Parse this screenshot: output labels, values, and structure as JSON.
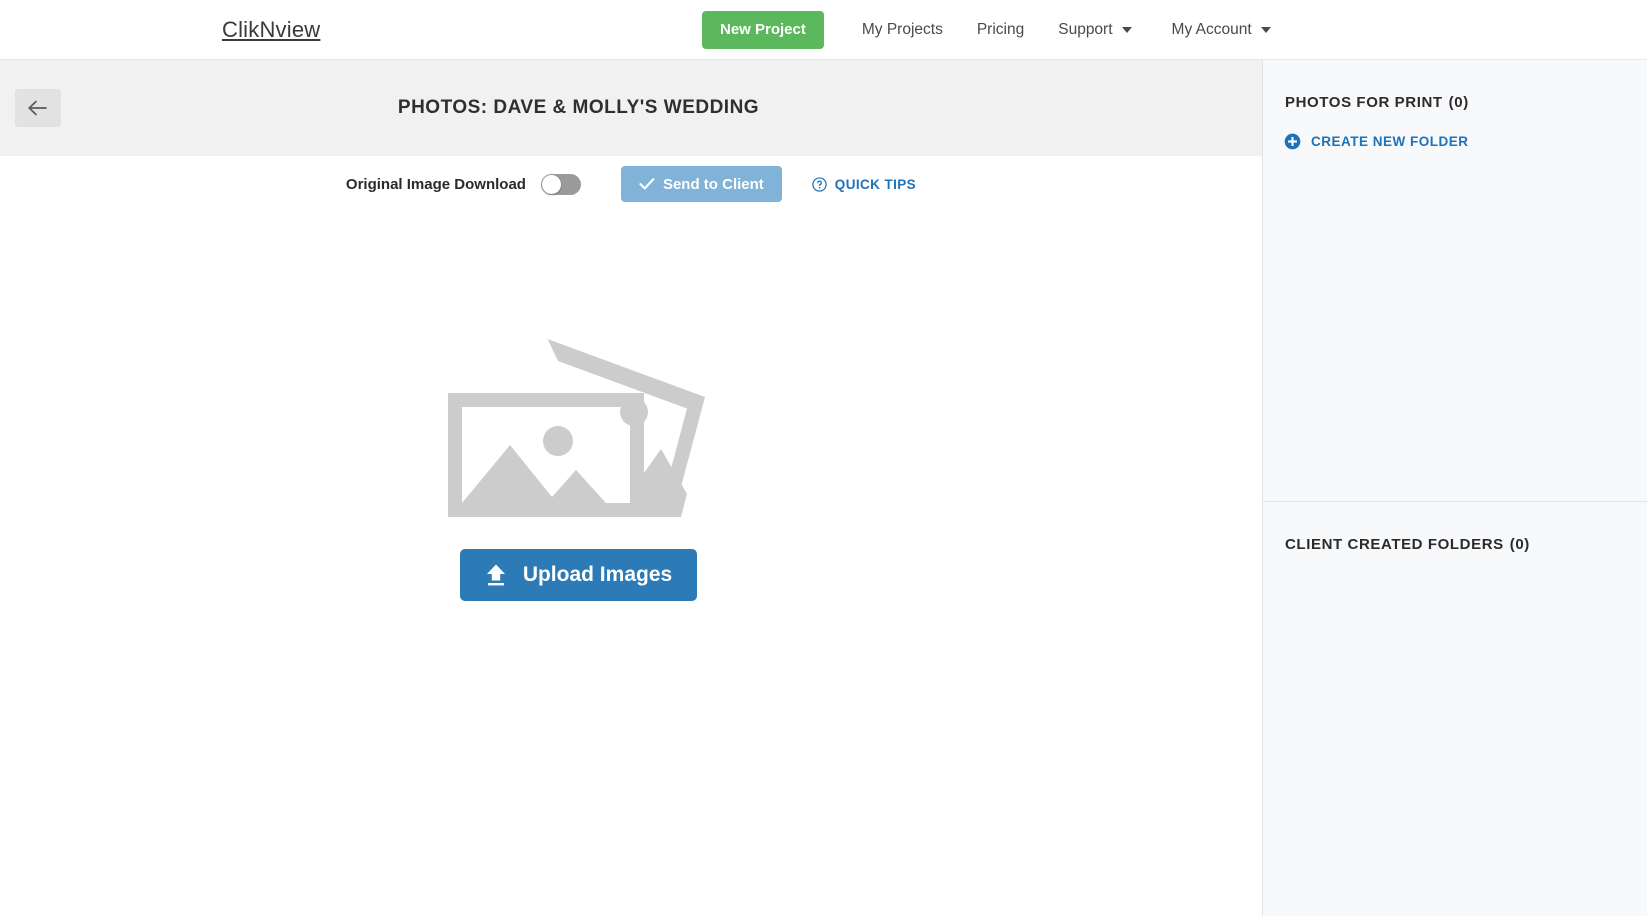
{
  "nav": {
    "brand": "ClikNview",
    "new_project_label": "New Project",
    "links": [
      {
        "label": "My Projects",
        "has_caret": false
      },
      {
        "label": "Pricing",
        "has_caret": false
      },
      {
        "label": "Support",
        "has_caret": true
      },
      {
        "label": "My Account",
        "has_caret": true
      }
    ]
  },
  "header": {
    "back_icon": "arrow-left-icon",
    "title": "PHOTOS: DAVE & MOLLY'S WEDDING"
  },
  "toolbar": {
    "original_download_label": "Original Image Download",
    "original_download_state": "off",
    "send_to_client_label": "Send to Client",
    "send_to_client_icon": "check-icon",
    "quick_tips_label": "QUICK TIPS",
    "quick_tips_icon": "question-circle-icon"
  },
  "main": {
    "placeholder_icon": "photos-placeholder-icon",
    "upload_label": "Upload Images",
    "upload_icon": "upload-arrow-icon"
  },
  "sidebar": {
    "sections": [
      {
        "title": "PHOTOS FOR PRINT",
        "count": "(0)",
        "action_label": "CREATE NEW FOLDER",
        "action_icon": "plus-circle-icon"
      },
      {
        "title": "CLIENT CREATED FOLDERS",
        "count": "(0)"
      }
    ]
  },
  "colors": {
    "brand_green": "#5cb85c",
    "accent_blue": "#1d72b8",
    "upload_blue": "#2c7bb6",
    "send_blue": "#81b2d8",
    "titlebar_gray": "#f1f1f1",
    "sidebar_bg": "#f8f9fb",
    "placeholder_gray": "#cccccc"
  }
}
